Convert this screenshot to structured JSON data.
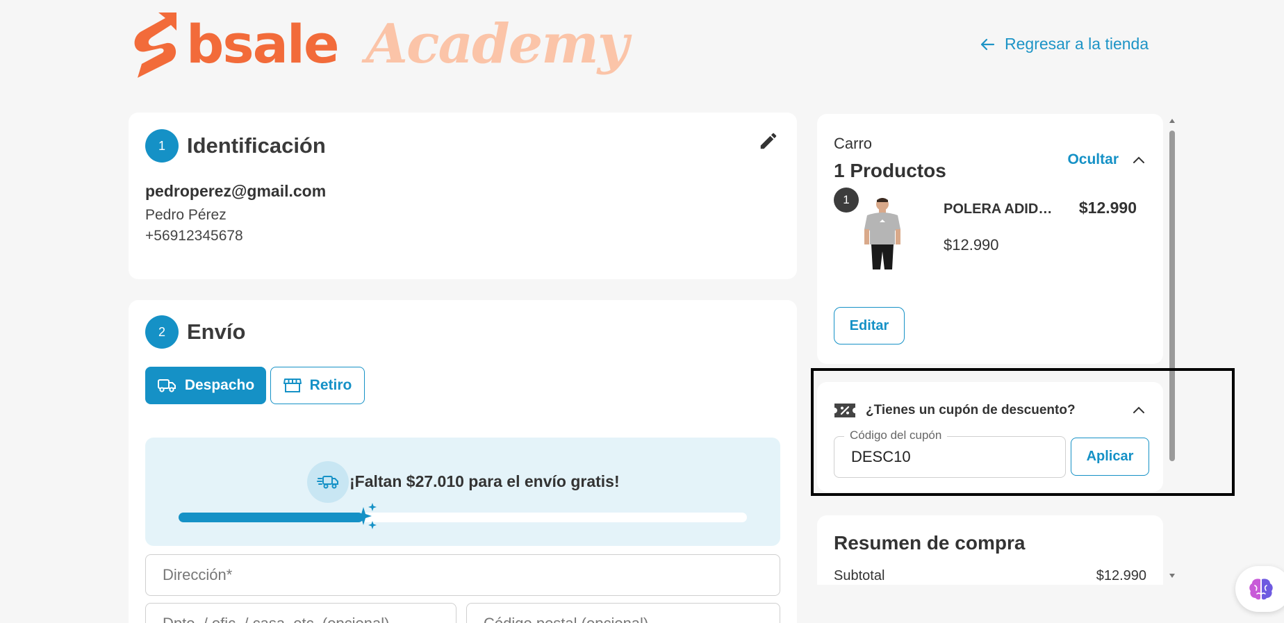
{
  "header": {
    "brand": "bsale",
    "brand_sub": "Academy",
    "back_link": "Regresar a la tienda"
  },
  "identification": {
    "step": "1",
    "title": "Identificación",
    "email": "pedroperez@gmail.com",
    "name": "Pedro Pérez",
    "phone": "+56912345678"
  },
  "shipping": {
    "step": "2",
    "title": "Envío",
    "option_delivery": "Despacho",
    "option_pickup": "Retiro",
    "free_shipping_msg": "¡Faltan $27.010 para el envío gratis!",
    "progress_fraction": 0.325,
    "address_placeholder": "Dirección*",
    "apartment_placeholder": "Dpto. / ofic. / casa, etc. (opcional)",
    "postal_placeholder": "Código postal (opcional)"
  },
  "cart": {
    "label": "Carro",
    "count_label": "1 Productos",
    "toggle_label": "Ocultar",
    "product": {
      "qty": "1",
      "name": "POLERA ADIDAS",
      "unit_price": "$12.990",
      "line_total": "$12.990"
    },
    "edit_label": "Editar"
  },
  "coupon": {
    "question": "¿Tienes un cupón de descuento?",
    "field_label": "Código del cupón",
    "value": "DESC10",
    "apply_label": "Aplicar"
  },
  "summary": {
    "title": "Resumen de compra",
    "subtotal_label": "Subtotal",
    "subtotal_value": "$12.990"
  },
  "colors": {
    "accent": "#1591c6",
    "brand_orange": "#f26b3a",
    "brand_peach": "#fbc4a8"
  }
}
